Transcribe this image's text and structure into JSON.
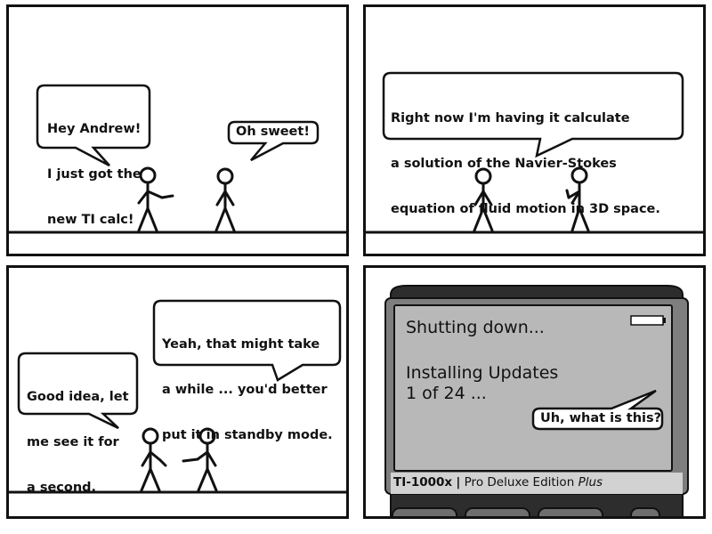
{
  "panel1": {
    "speech_left": [
      "Hey Andrew!",
      "I just got the",
      "new TI calc!"
    ],
    "speech_right": "Oh sweet!"
  },
  "panel2": {
    "speech": [
      "Right now I'm having it calculate",
      "a solution of the Navier-Stokes",
      "equation of fluid motion in 3D space."
    ]
  },
  "panel3": {
    "speech_right": [
      "Yeah, that might take",
      "a while ... you'd better",
      "put it in standby mode."
    ],
    "speech_left": [
      "Good idea, let",
      "me see it for",
      "a second."
    ]
  },
  "panel4": {
    "screen_line1": "Shutting down...",
    "screen_line2": "Installing Updates",
    "screen_line3": "1 of 24 ...",
    "speech": "Uh, what is this?",
    "brand_model": "TI-1000x",
    "brand_separator": "|",
    "brand_edition": "Pro Deluxe Edition",
    "brand_plus": "Plus",
    "icon": "battery-icon"
  }
}
